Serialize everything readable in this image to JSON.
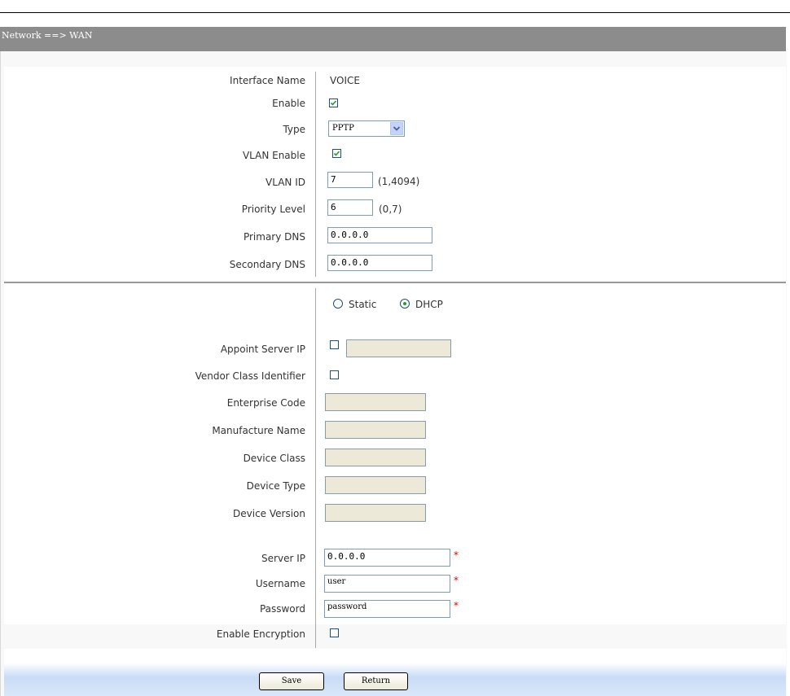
{
  "breadcrumb": "Network ==> WAN",
  "interface": {
    "name_label": "Interface Name",
    "name_value": "VOICE",
    "enable_label": "Enable",
    "enable_checked": true,
    "type_label": "Type",
    "type_value": "PPTP",
    "vlan_enable_label": "VLAN Enable",
    "vlan_enable_checked": true,
    "vlan_id_label": "VLAN ID",
    "vlan_id_value": "7",
    "vlan_id_range": "(1,4094)",
    "priority_label": "Priority Level",
    "priority_value": "6",
    "priority_range": "(0,7)",
    "primary_dns_label": "Primary DNS",
    "primary_dns_value": "0.0.0.0",
    "secondary_dns_label": "Secondary DNS",
    "secondary_dns_value": "0.0.0.0"
  },
  "addressing": {
    "static_label": "Static",
    "dhcp_label": "DHCP",
    "selected": "DHCP",
    "appoint_server_ip_label": "Appoint Server IP",
    "appoint_server_ip_checked": false,
    "vendor_class_label": "Vendor Class Identifier",
    "vendor_class_checked": false,
    "enterprise_code_label": "Enterprise Code",
    "manufacture_name_label": "Manufacture Name",
    "device_class_label": "Device Class",
    "device_type_label": "Device Type",
    "device_version_label": "Device Version"
  },
  "pptp": {
    "server_ip_label": "Server IP",
    "server_ip_value": "0.0.0.0",
    "username_label": "Username",
    "username_value": "user",
    "password_label": "Password",
    "password_value": "password",
    "encryption_label": "Enable Encryption",
    "encryption_checked": false,
    "required_mark": "*"
  },
  "buttons": {
    "save": "Save",
    "return": "Return"
  },
  "colors": {
    "title_bar": "#8c8c8c",
    "check": "#21a121",
    "required": "#e00000"
  }
}
